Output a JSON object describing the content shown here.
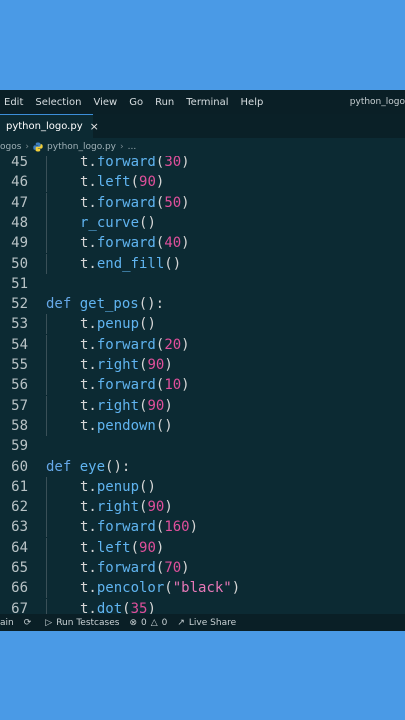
{
  "menu": [
    "Edit",
    "Selection",
    "View",
    "Go",
    "Run",
    "Terminal",
    "Help"
  ],
  "window_title": "python_logo",
  "tab": {
    "label": "python_logo.py",
    "close": "×"
  },
  "breadcrumb": {
    "folder": "ogos",
    "file": "python_logo.py",
    "more": "..."
  },
  "code_lines": [
    {
      "n": "45",
      "indent": true,
      "tokens": [
        [
          "t.",
          ""
        ],
        [
          "forward",
          "fn"
        ],
        [
          "(",
          ""
        ],
        [
          "30",
          "num"
        ],
        [
          ")",
          ""
        ]
      ]
    },
    {
      "n": "46",
      "indent": true,
      "tokens": [
        [
          "t.",
          ""
        ],
        [
          "left",
          "fn"
        ],
        [
          "(",
          ""
        ],
        [
          "90",
          "num"
        ],
        [
          ")",
          ""
        ]
      ]
    },
    {
      "n": "47",
      "indent": true,
      "tokens": [
        [
          "t.",
          ""
        ],
        [
          "forward",
          "fn"
        ],
        [
          "(",
          ""
        ],
        [
          "50",
          "num"
        ],
        [
          ")",
          ""
        ]
      ]
    },
    {
      "n": "48",
      "indent": true,
      "tokens": [
        [
          "r_curve",
          "fn"
        ],
        [
          "()",
          ""
        ]
      ]
    },
    {
      "n": "49",
      "indent": true,
      "tokens": [
        [
          "t.",
          ""
        ],
        [
          "forward",
          "fn"
        ],
        [
          "(",
          ""
        ],
        [
          "40",
          "num"
        ],
        [
          ")",
          ""
        ]
      ]
    },
    {
      "n": "50",
      "indent": true,
      "tokens": [
        [
          "t.",
          ""
        ],
        [
          "end_fill",
          "fn"
        ],
        [
          "()",
          ""
        ]
      ]
    },
    {
      "n": "51",
      "indent": false,
      "tokens": []
    },
    {
      "n": "52",
      "indent": false,
      "tokens": [
        [
          "def ",
          "kw"
        ],
        [
          "get_pos",
          "fn"
        ],
        [
          "():",
          ""
        ]
      ]
    },
    {
      "n": "53",
      "indent": true,
      "tokens": [
        [
          "t.",
          ""
        ],
        [
          "penup",
          "fn"
        ],
        [
          "()",
          ""
        ]
      ]
    },
    {
      "n": "54",
      "indent": true,
      "tokens": [
        [
          "t.",
          ""
        ],
        [
          "forward",
          "fn"
        ],
        [
          "(",
          ""
        ],
        [
          "20",
          "num"
        ],
        [
          ")",
          ""
        ]
      ]
    },
    {
      "n": "55",
      "indent": true,
      "tokens": [
        [
          "t.",
          ""
        ],
        [
          "right",
          "fn"
        ],
        [
          "(",
          ""
        ],
        [
          "90",
          "num"
        ],
        [
          ")",
          ""
        ]
      ]
    },
    {
      "n": "56",
      "indent": true,
      "tokens": [
        [
          "t.",
          ""
        ],
        [
          "forward",
          "fn"
        ],
        [
          "(",
          ""
        ],
        [
          "10",
          "num"
        ],
        [
          ")",
          ""
        ]
      ]
    },
    {
      "n": "57",
      "indent": true,
      "tokens": [
        [
          "t.",
          ""
        ],
        [
          "right",
          "fn"
        ],
        [
          "(",
          ""
        ],
        [
          "90",
          "num"
        ],
        [
          ")",
          ""
        ]
      ]
    },
    {
      "n": "58",
      "indent": true,
      "tokens": [
        [
          "t.",
          ""
        ],
        [
          "pendown",
          "fn"
        ],
        [
          "()",
          ""
        ]
      ]
    },
    {
      "n": "59",
      "indent": false,
      "tokens": []
    },
    {
      "n": "60",
      "indent": false,
      "tokens": [
        [
          "def ",
          "kw"
        ],
        [
          "eye",
          "fn"
        ],
        [
          "():",
          ""
        ]
      ]
    },
    {
      "n": "61",
      "indent": true,
      "tokens": [
        [
          "t.",
          ""
        ],
        [
          "penup",
          "fn"
        ],
        [
          "()",
          ""
        ]
      ]
    },
    {
      "n": "62",
      "indent": true,
      "tokens": [
        [
          "t.",
          ""
        ],
        [
          "right",
          "fn"
        ],
        [
          "(",
          ""
        ],
        [
          "90",
          "num"
        ],
        [
          ")",
          ""
        ]
      ]
    },
    {
      "n": "63",
      "indent": true,
      "tokens": [
        [
          "t.",
          ""
        ],
        [
          "forward",
          "fn"
        ],
        [
          "(",
          ""
        ],
        [
          "160",
          "num"
        ],
        [
          ")",
          ""
        ]
      ]
    },
    {
      "n": "64",
      "indent": true,
      "tokens": [
        [
          "t.",
          ""
        ],
        [
          "left",
          "fn"
        ],
        [
          "(",
          ""
        ],
        [
          "90",
          "num"
        ],
        [
          ")",
          ""
        ]
      ]
    },
    {
      "n": "65",
      "indent": true,
      "tokens": [
        [
          "t.",
          ""
        ],
        [
          "forward",
          "fn"
        ],
        [
          "(",
          ""
        ],
        [
          "70",
          "num"
        ],
        [
          ")",
          ""
        ]
      ]
    },
    {
      "n": "66",
      "indent": true,
      "tokens": [
        [
          "t.",
          ""
        ],
        [
          "pencolor",
          "fn"
        ],
        [
          "(",
          ""
        ],
        [
          "\"black\"",
          "str"
        ],
        [
          ")",
          ""
        ]
      ]
    },
    {
      "n": "67",
      "indent": true,
      "tokens": [
        [
          "t.",
          ""
        ],
        [
          "dot",
          "fn"
        ],
        [
          "(",
          ""
        ],
        [
          "35",
          "num"
        ],
        [
          ")",
          ""
        ]
      ]
    }
  ],
  "status": {
    "branch": "ain",
    "run_testcases": "Run Testcases",
    "errors": "0",
    "warnings": "0",
    "live_share": "Live Share"
  },
  "colors": {
    "background": "#4a9ae6",
    "editor_bg": "#0c2a33",
    "function": "#60b4f0",
    "number": "#e0509c",
    "keyword": "#66a8e8"
  },
  "icons": [
    "python-file-icon",
    "sync-icon",
    "run-icon",
    "error-icon",
    "warning-icon",
    "live-share-icon"
  ]
}
